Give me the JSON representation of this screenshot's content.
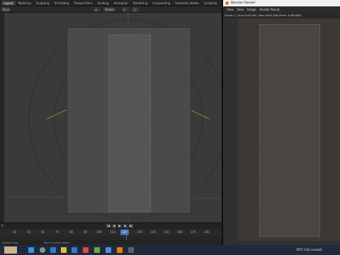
{
  "workspace_tabs": [
    "Layout",
    "Modeling",
    "Sculpting",
    "UV Editing",
    "Texture Paint",
    "Shading",
    "Animation",
    "Rendering",
    "Compositing",
    "Geometry Nodes",
    "Scripting"
  ],
  "viewport": {
    "mode": "Pose",
    "transform_orientation": "Global"
  },
  "timeline": {
    "left_label": "V",
    "ticks": [
      "40",
      "50",
      "60",
      "70",
      "80",
      "90",
      "100",
      "110",
      "120",
      "130",
      "140",
      "150",
      "160",
      "170",
      "180"
    ],
    "current_frame": "120"
  },
  "render_window": {
    "title": "Blender Render",
    "menus": [
      "View",
      "View",
      "Image",
      "Render Result"
    ],
    "status": "Frame:1 | Time:00:03.84 | Mem:3093.28M (Peak: 3196.84M)"
  },
  "statusbar": {
    "left": "Rotate View",
    "right": "Pose Context Menu"
  },
  "taskbar": {
    "weather": "19°C  Ciel couvert"
  },
  "colors": {
    "accent": "#4772b3",
    "rig_yellow": "#e0c020",
    "rig_green": "#40c050",
    "rig_red": "#c04040",
    "blender_orange": "#e87d0d"
  }
}
